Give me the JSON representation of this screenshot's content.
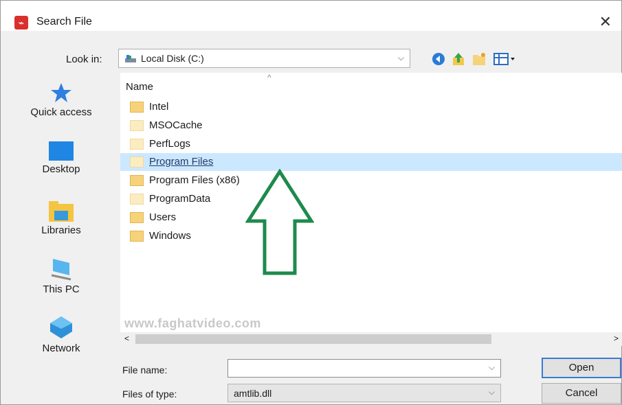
{
  "window": {
    "title": "Search File",
    "close_glyph": "✕",
    "app_icon_name": "acrobat-app-icon"
  },
  "toolbar": {
    "look_in_label": "Look in:",
    "look_in_value": "Local Disk (C:)",
    "buttons": [
      "back-icon",
      "up-folder-icon",
      "new-folder-icon",
      "view-menu-icon"
    ]
  },
  "places": [
    {
      "label": "Quick access",
      "icon": "star-icon"
    },
    {
      "label": "Desktop",
      "icon": "desktop-icon"
    },
    {
      "label": "Libraries",
      "icon": "libraries-icon"
    },
    {
      "label": "This PC",
      "icon": "computer-icon"
    },
    {
      "label": "Network",
      "icon": "network-icon"
    }
  ],
  "file_list": {
    "column_header": "Name",
    "items": [
      {
        "name": "Intel",
        "selected": false
      },
      {
        "name": "MSOCache",
        "selected": false
      },
      {
        "name": "PerfLogs",
        "selected": false
      },
      {
        "name": "Program Files",
        "selected": true
      },
      {
        "name": "Program Files (x86)",
        "selected": false
      },
      {
        "name": "ProgramData",
        "selected": false
      },
      {
        "name": "Users",
        "selected": false
      },
      {
        "name": "Windows",
        "selected": false
      }
    ],
    "watermark": "www.faghatvideo.com"
  },
  "form": {
    "file_name_label": "File name:",
    "file_name_value": "",
    "file_type_label": "Files of type:",
    "file_type_value": "amtlib.dll"
  },
  "buttons": {
    "open": "Open",
    "cancel": "Cancel"
  },
  "annotation": {
    "arrow_color": "#1e8a4c"
  }
}
